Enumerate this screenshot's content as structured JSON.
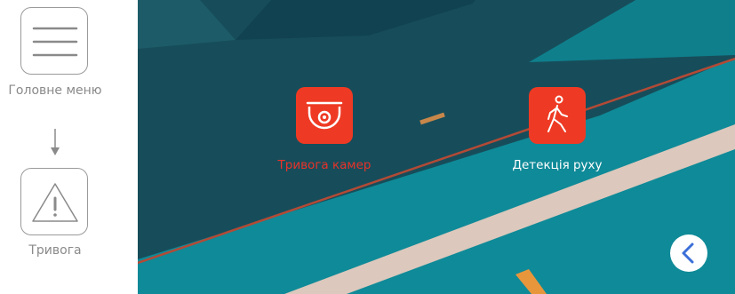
{
  "guide": {
    "menu_label": "Головне меню",
    "alarm_label": "Тривога",
    "menu_icon": "hamburger-icon",
    "alarm_icon": "warning-triangle-icon",
    "arrow_icon": "arrow-down-icon"
  },
  "screen": {
    "items": [
      {
        "label": "Тривога камер",
        "icon": "dome-camera-icon",
        "state": "selected",
        "label_color": "#e8322a"
      },
      {
        "label": "Детекція руху",
        "icon": "walking-person-icon",
        "state": "normal",
        "label_color": "#ffffff"
      }
    ],
    "back_button_icon": "chevron-left-icon",
    "accent_color": "#ee3a24",
    "back_icon_color": "#3b6fd8"
  }
}
